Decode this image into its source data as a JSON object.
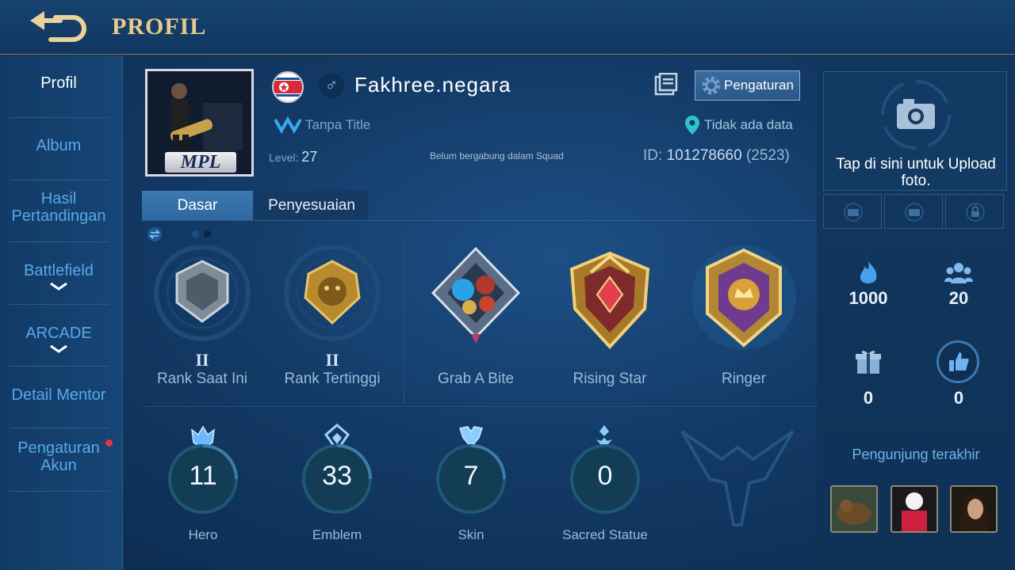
{
  "header": {
    "title": "PROFIL",
    "back_icon": "back-arrow-icon"
  },
  "sidebar": {
    "items": [
      {
        "label": "Profil"
      },
      {
        "label": "Album"
      },
      {
        "label": "Hasil Pertandingan"
      },
      {
        "label": "Battlefield"
      },
      {
        "label": "ARCADE"
      },
      {
        "label": "Detail Mentor"
      },
      {
        "label": "Pengaturan Akun"
      }
    ]
  },
  "profile": {
    "name": "Fakhree.negara",
    "avatar_badge": "MPL",
    "title": "Tanpa Title",
    "location": "Tidak ada data",
    "level_label": "Level:",
    "level": "27",
    "squad": "Belum bergabung dalam Squad",
    "id_label": "ID:",
    "id": "101278660",
    "server": "(2523)",
    "settings_label": "Pengaturan"
  },
  "tabs": [
    {
      "label": "Dasar"
    },
    {
      "label": "Penyesuaian"
    }
  ],
  "badges": [
    {
      "label": "Rank Saat Ini",
      "tier": "II"
    },
    {
      "label": "Rank Tertinggi",
      "tier": "II"
    },
    {
      "label": "Grab A Bite"
    },
    {
      "label": "Rising Star"
    },
    {
      "label": "Ringer"
    }
  ],
  "stats": [
    {
      "label": "Hero",
      "value": "11"
    },
    {
      "label": "Emblem",
      "value": "33"
    },
    {
      "label": "Skin",
      "value": "7"
    },
    {
      "label": "Sacred Statue",
      "value": "0"
    }
  ],
  "right_panel": {
    "upload_text": "Tap di sini untuk Upload foto.",
    "popularity": "1000",
    "followers": "20",
    "gifts": "0",
    "likes": "0",
    "visitors_label": "Pengunjung terakhir"
  },
  "colors": {
    "accent_gold": "#e6cb8a",
    "accent_blue": "#58a9e8",
    "panel_bg": "#133a66"
  }
}
